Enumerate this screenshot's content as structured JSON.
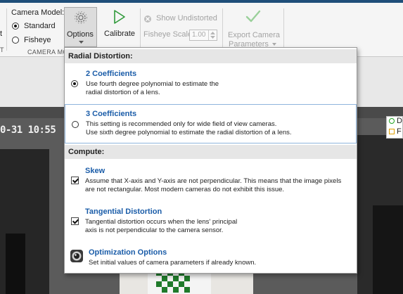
{
  "ribbon": {
    "camera_model_label": "Camera Model:",
    "standard_label": "Standard",
    "fisheye_label": "Fisheye",
    "camera_model_group": "CAMERA MO",
    "options_label": "Options",
    "calibrate_label": "Calibrate",
    "show_undistorted_label": "Show Undistorted",
    "fisheye_scale_label": "Fisheye Scale",
    "fisheye_scale_value": "1.00",
    "export_line1": "Export Camera",
    "export_line2": "Parameters",
    "left_cut_t": "t",
    "left_cut_T": "T"
  },
  "camera": {
    "timestamp": "0-31 10:55",
    "legend_letter_1": "D",
    "legend_letter_2": "F"
  },
  "dropdown": {
    "radial_header": "Radial Distortion:",
    "coef2_title": "2 Coefficients",
    "coef2_desc1": "Use fourth degree polynomial to estimate the",
    "coef2_desc2": "radial distortion of a lens.",
    "coef3_title": "3 Coefficients",
    "coef3_desc1": "This setting is recommended only for wide field of view cameras.",
    "coef3_desc2": "Use sixth degree polynomial to estimate the radial distortion of a lens.",
    "compute_header": "Compute:",
    "skew_title": "Skew",
    "skew_desc1": "Assume that X-axis and Y-axis are not perpendicular. This means that the image pixels",
    "skew_desc2": "are not rectangular. Most modern cameras do not exhibit this issue.",
    "tangential_title": "Tangential Distortion",
    "tangential_desc1": "Tangential distortion occurs when the lens' principal",
    "tangential_desc2": "axis is not perpendicular to the camera sensor.",
    "optimization_title": "Optimization Options",
    "optimization_desc": "Set initial values of camera parameters if already known."
  },
  "state": {
    "camera_model_selected": "Standard",
    "radial_selected": "2 Coefficients",
    "skew_checked": true,
    "tangential_checked": true
  },
  "colors": {
    "link_blue": "#1a5ca8",
    "calibrate_green": "#2f9a3a",
    "export_green": "#8fce8f",
    "title_bar": "#1f4e79"
  },
  "icons": [
    "gear-icon",
    "play-icon",
    "undistort-icon",
    "checkmark-icon",
    "dropdown-arrow-icon",
    "camera-lens-icon"
  ]
}
